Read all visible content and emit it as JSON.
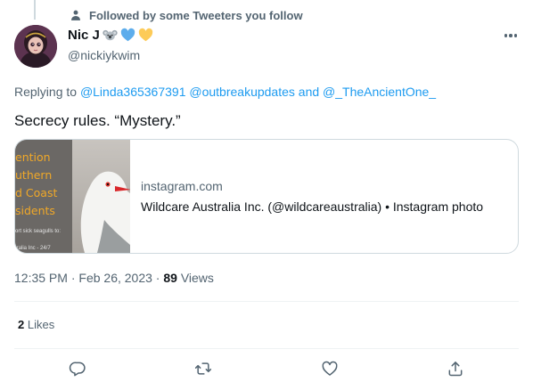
{
  "social_context": {
    "text": "Followed by some Tweeters you follow"
  },
  "author": {
    "name": "Nic J",
    "handle": "@nickiykwim"
  },
  "reply": {
    "prefix": "Replying to",
    "mention_1": "@Linda365367391",
    "mention_2": "@outbreakupdates",
    "and": "and",
    "mention_3": "@_TheAncientOne_"
  },
  "tweet": {
    "text": "Secrecy rules. “Mystery.”"
  },
  "card": {
    "domain": "instagram.com",
    "title": "Wildcare Australia Inc. (@wildcareaustralia) • Instagram photo",
    "image_lines": [
      "ention",
      "uthern",
      "d Coast",
      "sidents"
    ],
    "image_small_1": "ort sick seagulls to:",
    "image_small_2": "tralia Inc - 24/7"
  },
  "meta": {
    "time": "12:35 PM",
    "sep1": "·",
    "date": "Feb 26, 2023",
    "sep2": "·",
    "views_count": "89",
    "views_label": "Views"
  },
  "likes": {
    "count": "2",
    "label": "Likes"
  },
  "icons": {
    "social": "person-icon",
    "emojis": [
      "koala-emoji-icon",
      "blue-heart-icon",
      "yellow-heart-icon"
    ],
    "more": "more-icon",
    "actions": [
      "reply-icon",
      "retweet-icon",
      "like-icon",
      "share-icon"
    ]
  },
  "colors": {
    "link": "#1d9bf0",
    "secondary": "#536471",
    "border": "#cfd9de"
  }
}
